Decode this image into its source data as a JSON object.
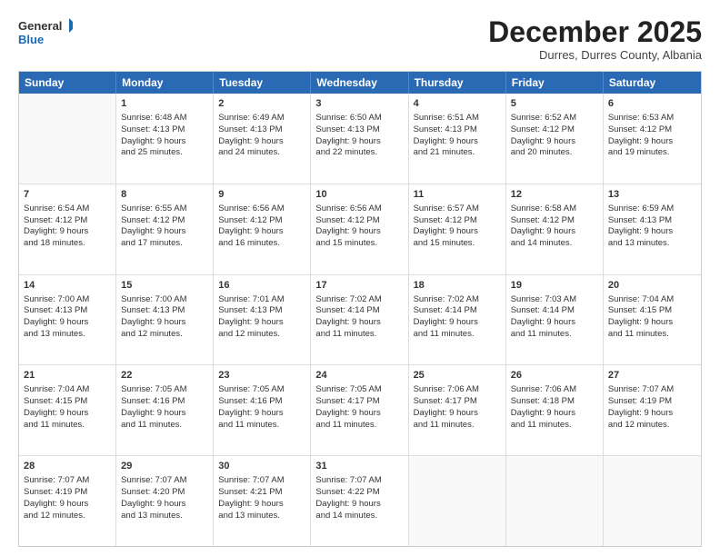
{
  "logo": {
    "general": "General",
    "blue": "Blue"
  },
  "header": {
    "month": "December 2025",
    "location": "Durres, Durres County, Albania"
  },
  "days": [
    "Sunday",
    "Monday",
    "Tuesday",
    "Wednesday",
    "Thursday",
    "Friday",
    "Saturday"
  ],
  "weeks": [
    [
      {
        "day": "",
        "lines": []
      },
      {
        "day": "1",
        "lines": [
          "Sunrise: 6:48 AM",
          "Sunset: 4:13 PM",
          "Daylight: 9 hours",
          "and 25 minutes."
        ]
      },
      {
        "day": "2",
        "lines": [
          "Sunrise: 6:49 AM",
          "Sunset: 4:13 PM",
          "Daylight: 9 hours",
          "and 24 minutes."
        ]
      },
      {
        "day": "3",
        "lines": [
          "Sunrise: 6:50 AM",
          "Sunset: 4:13 PM",
          "Daylight: 9 hours",
          "and 22 minutes."
        ]
      },
      {
        "day": "4",
        "lines": [
          "Sunrise: 6:51 AM",
          "Sunset: 4:13 PM",
          "Daylight: 9 hours",
          "and 21 minutes."
        ]
      },
      {
        "day": "5",
        "lines": [
          "Sunrise: 6:52 AM",
          "Sunset: 4:12 PM",
          "Daylight: 9 hours",
          "and 20 minutes."
        ]
      },
      {
        "day": "6",
        "lines": [
          "Sunrise: 6:53 AM",
          "Sunset: 4:12 PM",
          "Daylight: 9 hours",
          "and 19 minutes."
        ]
      }
    ],
    [
      {
        "day": "7",
        "lines": [
          "Sunrise: 6:54 AM",
          "Sunset: 4:12 PM",
          "Daylight: 9 hours",
          "and 18 minutes."
        ]
      },
      {
        "day": "8",
        "lines": [
          "Sunrise: 6:55 AM",
          "Sunset: 4:12 PM",
          "Daylight: 9 hours",
          "and 17 minutes."
        ]
      },
      {
        "day": "9",
        "lines": [
          "Sunrise: 6:56 AM",
          "Sunset: 4:12 PM",
          "Daylight: 9 hours",
          "and 16 minutes."
        ]
      },
      {
        "day": "10",
        "lines": [
          "Sunrise: 6:56 AM",
          "Sunset: 4:12 PM",
          "Daylight: 9 hours",
          "and 15 minutes."
        ]
      },
      {
        "day": "11",
        "lines": [
          "Sunrise: 6:57 AM",
          "Sunset: 4:12 PM",
          "Daylight: 9 hours",
          "and 15 minutes."
        ]
      },
      {
        "day": "12",
        "lines": [
          "Sunrise: 6:58 AM",
          "Sunset: 4:12 PM",
          "Daylight: 9 hours",
          "and 14 minutes."
        ]
      },
      {
        "day": "13",
        "lines": [
          "Sunrise: 6:59 AM",
          "Sunset: 4:13 PM",
          "Daylight: 9 hours",
          "and 13 minutes."
        ]
      }
    ],
    [
      {
        "day": "14",
        "lines": [
          "Sunrise: 7:00 AM",
          "Sunset: 4:13 PM",
          "Daylight: 9 hours",
          "and 13 minutes."
        ]
      },
      {
        "day": "15",
        "lines": [
          "Sunrise: 7:00 AM",
          "Sunset: 4:13 PM",
          "Daylight: 9 hours",
          "and 12 minutes."
        ]
      },
      {
        "day": "16",
        "lines": [
          "Sunrise: 7:01 AM",
          "Sunset: 4:13 PM",
          "Daylight: 9 hours",
          "and 12 minutes."
        ]
      },
      {
        "day": "17",
        "lines": [
          "Sunrise: 7:02 AM",
          "Sunset: 4:14 PM",
          "Daylight: 9 hours",
          "and 11 minutes."
        ]
      },
      {
        "day": "18",
        "lines": [
          "Sunrise: 7:02 AM",
          "Sunset: 4:14 PM",
          "Daylight: 9 hours",
          "and 11 minutes."
        ]
      },
      {
        "day": "19",
        "lines": [
          "Sunrise: 7:03 AM",
          "Sunset: 4:14 PM",
          "Daylight: 9 hours",
          "and 11 minutes."
        ]
      },
      {
        "day": "20",
        "lines": [
          "Sunrise: 7:04 AM",
          "Sunset: 4:15 PM",
          "Daylight: 9 hours",
          "and 11 minutes."
        ]
      }
    ],
    [
      {
        "day": "21",
        "lines": [
          "Sunrise: 7:04 AM",
          "Sunset: 4:15 PM",
          "Daylight: 9 hours",
          "and 11 minutes."
        ]
      },
      {
        "day": "22",
        "lines": [
          "Sunrise: 7:05 AM",
          "Sunset: 4:16 PM",
          "Daylight: 9 hours",
          "and 11 minutes."
        ]
      },
      {
        "day": "23",
        "lines": [
          "Sunrise: 7:05 AM",
          "Sunset: 4:16 PM",
          "Daylight: 9 hours",
          "and 11 minutes."
        ]
      },
      {
        "day": "24",
        "lines": [
          "Sunrise: 7:05 AM",
          "Sunset: 4:17 PM",
          "Daylight: 9 hours",
          "and 11 minutes."
        ]
      },
      {
        "day": "25",
        "lines": [
          "Sunrise: 7:06 AM",
          "Sunset: 4:17 PM",
          "Daylight: 9 hours",
          "and 11 minutes."
        ]
      },
      {
        "day": "26",
        "lines": [
          "Sunrise: 7:06 AM",
          "Sunset: 4:18 PM",
          "Daylight: 9 hours",
          "and 11 minutes."
        ]
      },
      {
        "day": "27",
        "lines": [
          "Sunrise: 7:07 AM",
          "Sunset: 4:19 PM",
          "Daylight: 9 hours",
          "and 12 minutes."
        ]
      }
    ],
    [
      {
        "day": "28",
        "lines": [
          "Sunrise: 7:07 AM",
          "Sunset: 4:19 PM",
          "Daylight: 9 hours",
          "and 12 minutes."
        ]
      },
      {
        "day": "29",
        "lines": [
          "Sunrise: 7:07 AM",
          "Sunset: 4:20 PM",
          "Daylight: 9 hours",
          "and 13 minutes."
        ]
      },
      {
        "day": "30",
        "lines": [
          "Sunrise: 7:07 AM",
          "Sunset: 4:21 PM",
          "Daylight: 9 hours",
          "and 13 minutes."
        ]
      },
      {
        "day": "31",
        "lines": [
          "Sunrise: 7:07 AM",
          "Sunset: 4:22 PM",
          "Daylight: 9 hours",
          "and 14 minutes."
        ]
      },
      {
        "day": "",
        "lines": []
      },
      {
        "day": "",
        "lines": []
      },
      {
        "day": "",
        "lines": []
      }
    ]
  ]
}
